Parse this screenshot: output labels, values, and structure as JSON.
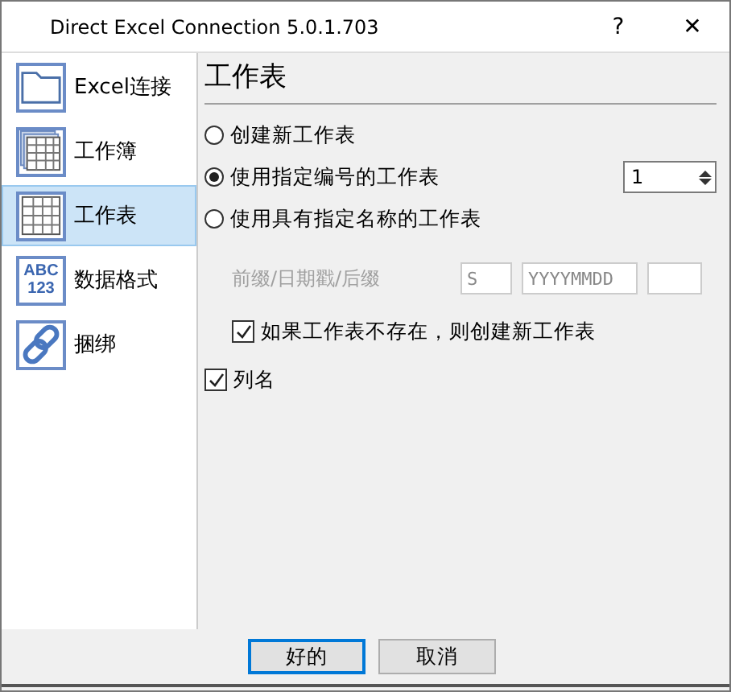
{
  "window": {
    "title": "Direct Excel Connection 5.0.1.703",
    "help": "?",
    "close": "✕"
  },
  "sidebar": {
    "items": [
      {
        "label": "Excel连接",
        "kind": "folder",
        "selected": false
      },
      {
        "label": "工作簿",
        "kind": "workbook",
        "selected": false
      },
      {
        "label": "工作表",
        "kind": "sheet",
        "selected": true
      },
      {
        "label": "数据格式",
        "kind": "format",
        "selected": false,
        "icon_text": [
          "ABC",
          "123"
        ]
      },
      {
        "label": "捆绑",
        "kind": "link",
        "selected": false
      }
    ]
  },
  "section_title": "工作表",
  "options": [
    {
      "label": "创建新工作表",
      "selected": false
    },
    {
      "label": "使用指定编号的工作表",
      "selected": true,
      "spinner": "1"
    },
    {
      "label": "使用具有指定名称的工作表",
      "selected": false
    }
  ],
  "name_parts": {
    "label": "前缀/日期戳/后缀",
    "disabled": true,
    "fields": [
      {
        "kind": "text",
        "value": "S"
      },
      {
        "kind": "text",
        "value": "YYYYMMDD"
      },
      {
        "kind": "empty"
      }
    ]
  },
  "create_if_missing": {
    "label": "如果工作表不存在，则创建新工作表",
    "checked": true
  },
  "column_names": {
    "label": "列名",
    "checked": true
  },
  "buttons": [
    {
      "label": "好的",
      "default": true
    },
    {
      "label": "取消",
      "default": false
    }
  ]
}
